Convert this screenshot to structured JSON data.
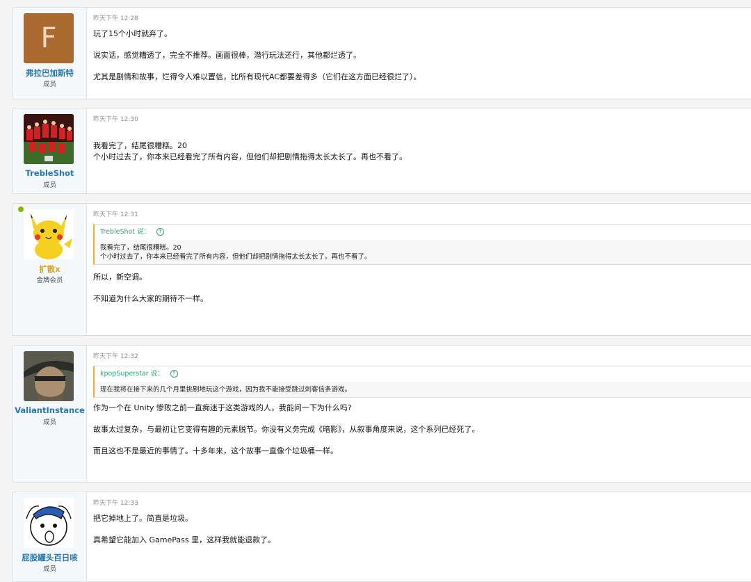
{
  "posts": [
    {
      "username": "弗拉巴加斯特",
      "title": "成员",
      "avatar_letter": "F",
      "avatar_color": "#a9692f",
      "time": "昨天下午 12:28",
      "paragraphs": [
        "玩了15个小时就弃了。",
        "说实话，感觉糟透了，完全不推荐。画面很棒，潜行玩法还行，其他都烂透了。",
        "尤其是剧情和故事，烂得令人难以置信，比所有现代AC都要差得多（它们在这方面已经很烂了）。"
      ]
    },
    {
      "username": "TrebleShot",
      "title": "成员",
      "time": "昨天下午 12:30",
      "paragraphs": [
        "我看完了，结尾很糟糕。20\n个小时过去了，你本来已经看完了所有内容，但他们却把剧情拖得太长太长了。再也不看了。"
      ]
    },
    {
      "username": "扩散x",
      "title": "金牌会员",
      "time": "昨天下午 12:31",
      "quote": {
        "author": "TrebleShot 说：",
        "text_line1": "我看完了，结尾很糟糕。20",
        "text_line2": "个小时过去了，你本来已经看完了所有内容，但他们却把剧情拖得太长太长了。再也不看了。"
      },
      "paragraphs": [
        "所以，新空调。",
        "不知道为什么大家的期待不一样。"
      ]
    },
    {
      "username": "ValiantInstance",
      "title": "成员",
      "time": "昨天下午 12:32",
      "quote": {
        "author": "kpopSuperstar 说：",
        "text_line1": "现在我将在接下来的几个月里挑剔地玩这个游戏，因为我不能接受跳过刺客信条游戏。"
      },
      "paragraphs": [
        "作为一个在 Unity 惨败之前一直痴迷于这类游戏的人，我能问一下为什么吗?",
        "故事太过复杂，与最初让它变得有趣的元素脱节。你没有义务完成《暗影》，从叙事角度来说，这个系列已经死了。",
        "而且这也不是最近的事情了。十多年来，这个故事一直像个垃圾桶一样。"
      ]
    },
    {
      "username": "屁股罐头百日咳",
      "title": "成员",
      "time": "昨天下午 12:33",
      "paragraphs": [
        "把它掉地上了。简直是垃圾。",
        "真希望它能加入 GamePass 里，这样我就能退款了。"
      ]
    }
  ]
}
